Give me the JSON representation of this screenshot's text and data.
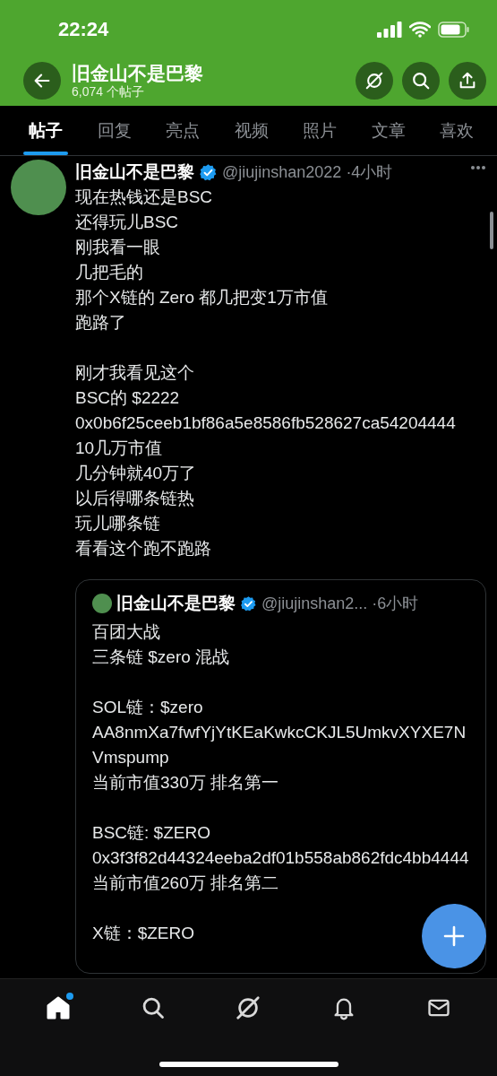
{
  "status_bar": {
    "time": "22:24"
  },
  "header": {
    "title": "旧金山不是巴黎",
    "subtitle": "6,074 个帖子"
  },
  "tabs": [
    {
      "label": "帖子",
      "selected": true
    },
    {
      "label": "回复",
      "selected": false
    },
    {
      "label": "亮点",
      "selected": false
    },
    {
      "label": "视频",
      "selected": false
    },
    {
      "label": "照片",
      "selected": false
    },
    {
      "label": "文章",
      "selected": false
    },
    {
      "label": "喜欢",
      "selected": false
    }
  ],
  "post": {
    "author": "旧金山不是巴黎",
    "verified": true,
    "handle": "@jiujinshan2022",
    "time": "·4小时",
    "paragraphs": [
      [
        "现在热钱还是BSC",
        "还得玩儿BSC",
        "刚我看一眼",
        "几把毛的",
        "那个X链的 Zero 都几把变1万市值",
        "跑路了"
      ],
      [
        "刚才我看见这个",
        "BSC的 $2222",
        "0x0b6f25ceeb1bf86a5e8586fb528627ca54204444",
        "10几万市值",
        "几分钟就40万了",
        "以后得哪条链热",
        "玩儿哪条链",
        "看看这个跑不跑路"
      ]
    ],
    "quote": {
      "author": "旧金山不是巴黎",
      "verified": true,
      "handle": "@jiujinshan2...",
      "time": "·6小时",
      "paragraphs": [
        [
          "百团大战",
          "三条链 $zero 混战"
        ],
        [
          "SOL链：$zero",
          "AA8nmXa7fwfYjYtKEaKwkcCKJL5UmkvXYXE7NVmspump",
          "当前市值330万 排名第一"
        ],
        [
          "BSC链: $ZERO",
          "0x3f3f82d44324eeba2df01b558ab862fdc4bb4444",
          "当前市值260万 排名第二"
        ],
        [
          "X链：$ZERO"
        ]
      ]
    }
  },
  "bottom_nav": [
    {
      "kind": "home",
      "selected": true,
      "dot": true
    },
    {
      "kind": "search",
      "selected": false,
      "dot": false
    },
    {
      "kind": "grok",
      "selected": false,
      "dot": false
    },
    {
      "kind": "bell",
      "selected": false,
      "dot": false
    },
    {
      "kind": "mail",
      "selected": false,
      "dot": false
    }
  ]
}
